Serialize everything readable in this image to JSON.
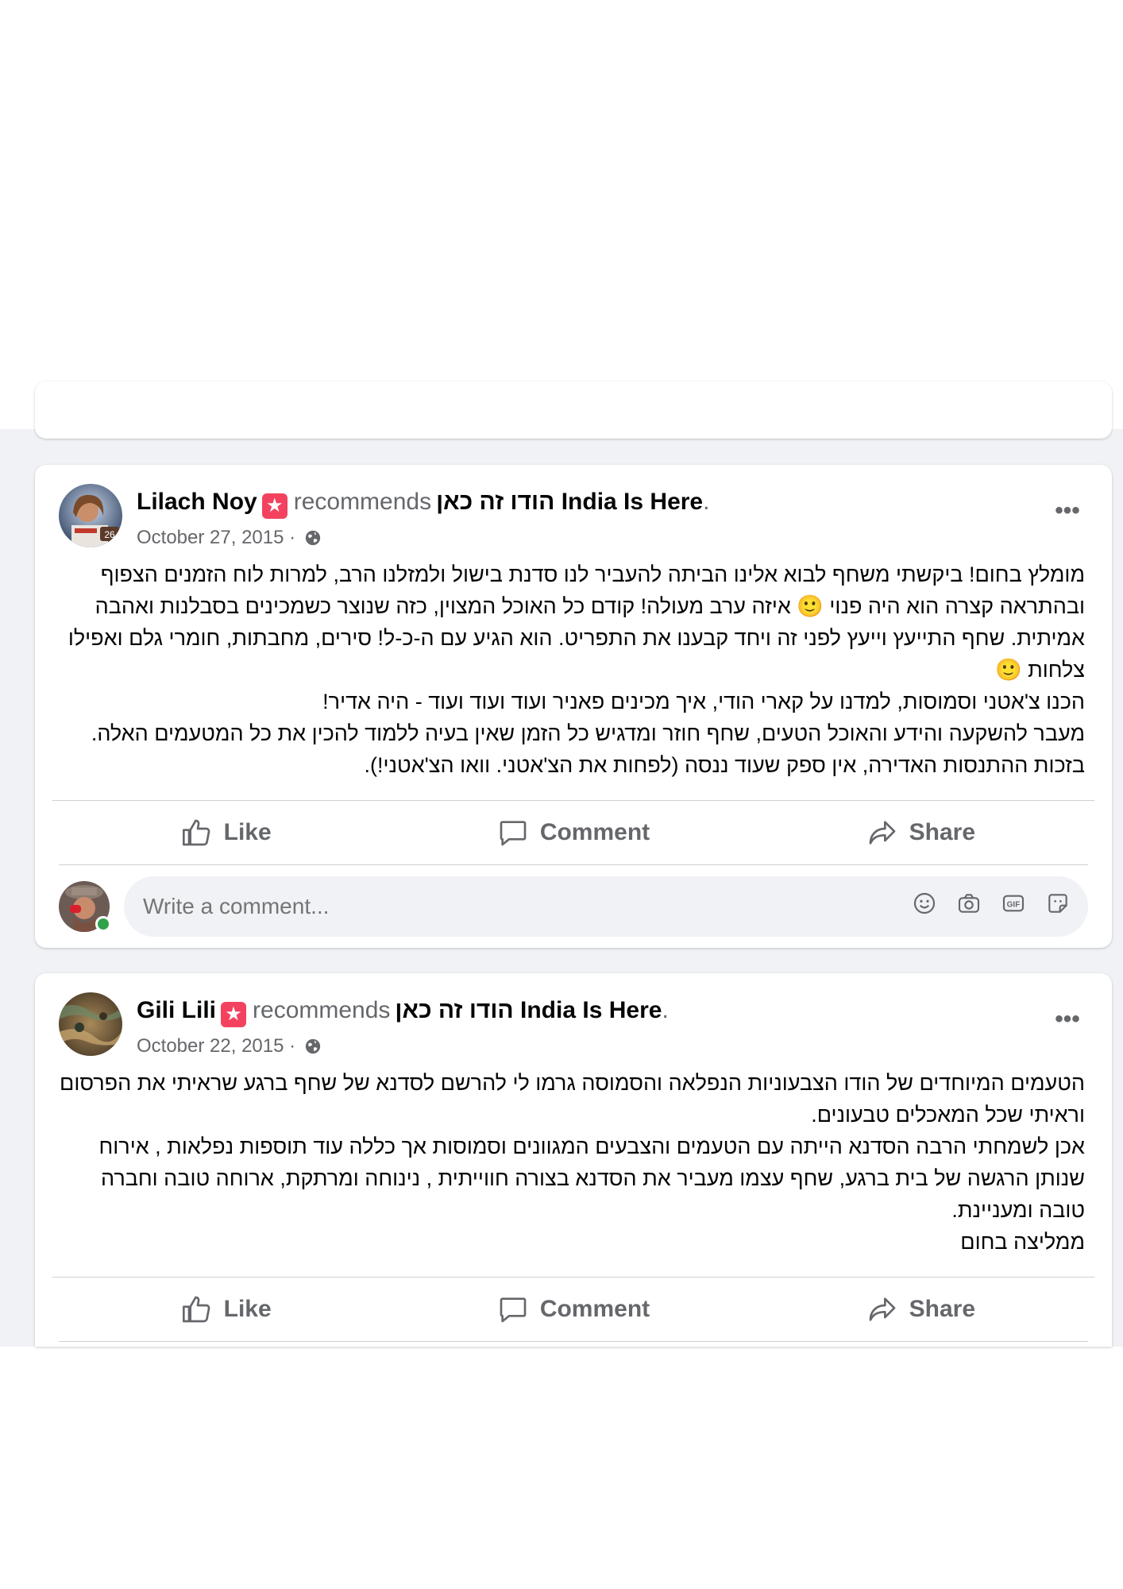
{
  "posts": [
    {
      "author": "Lilach Noy",
      "verb": "recommends",
      "page": "הודו זה כאן India Is Here",
      "period": ".",
      "date": "October 27, 2015 ·",
      "paragraphs": [
        "מומלץ בחום! ביקשתי משחף לבוא אלינו הביתה להעביר לנו סדנת בישול ולמזלנו הרב, למרות לוח הזמנים הצפוף ובהתראה קצרה הוא היה פנוי 🙂 איזה ערב מעולה! קודם כל האוכל המצוין, כזה שנוצר כשמכינים בסבלנות ואהבה אמיתית. שחף התייעץ וייעץ לפני זה ויחד קבענו את התפריט. הוא הגיע עם ה-כ-ל! סירים, מחבתות, חומרי גלם ואפילו צלחות 🙂",
        "הכנו צ'אטני וסמוסות, למדנו על קארי הודי, איך מכינים פאניר ועוד ועוד ועוד - היה אדיר!",
        "מעבר להשקעה והידע והאוכל הטעים, שחף חוזר ומדגיש כל הזמן שאין בעיה ללמוד להכין את כל המטעמים האלה. בזכות ההתנסות האדירה, אין ספק שעוד ננסה (לפחות את הצ'אטני. וואו הצ'אטני!)."
      ],
      "avatar_badge": "26"
    },
    {
      "author": "Gili Lili",
      "verb": "recommends",
      "page": "הודו זה כאן India Is Here",
      "period": ".",
      "date": "October 22, 2015 ·",
      "paragraphs": [
        "הטעמים המיוחדים של הודו הצבעוניות הנפלאה והסמוסה גרמו לי להרשם לסדנא של שחף ברגע שראיתי את הפרסום וראיתי שכל המאכלים טבעונים.",
        "אכן לשמחתי הרבה הסדנא הייתה עם הטעמים והצבעים המגוונים וסמוסות אך כללה עוד תוספות נפלאות , אירוח שנותן הרגשה של בית ברגע, שחף עצמו מעביר את הסדנא בצורה חווייתית , נינוחה ומרתקת, ארוחה טובה וחברה טובה ומעניינת.",
        "ממליצה בחום"
      ]
    }
  ],
  "actions": {
    "like": "Like",
    "comment": "Comment",
    "share": "Share"
  },
  "comment_box": {
    "placeholder": "Write a comment..."
  },
  "more_label": "•••",
  "badge_glyph": "★",
  "colors": {
    "feed_bg": "#f0f2f5",
    "recommend_badge": "#f3425f",
    "online": "#31a24c",
    "muted": "#65676b"
  },
  "icons": [
    "globe-icon",
    "like-icon",
    "comment-icon",
    "share-icon",
    "emoji-icon",
    "camera-icon",
    "gif-icon",
    "sticker-icon",
    "more-icon",
    "recommend-badge-icon"
  ]
}
